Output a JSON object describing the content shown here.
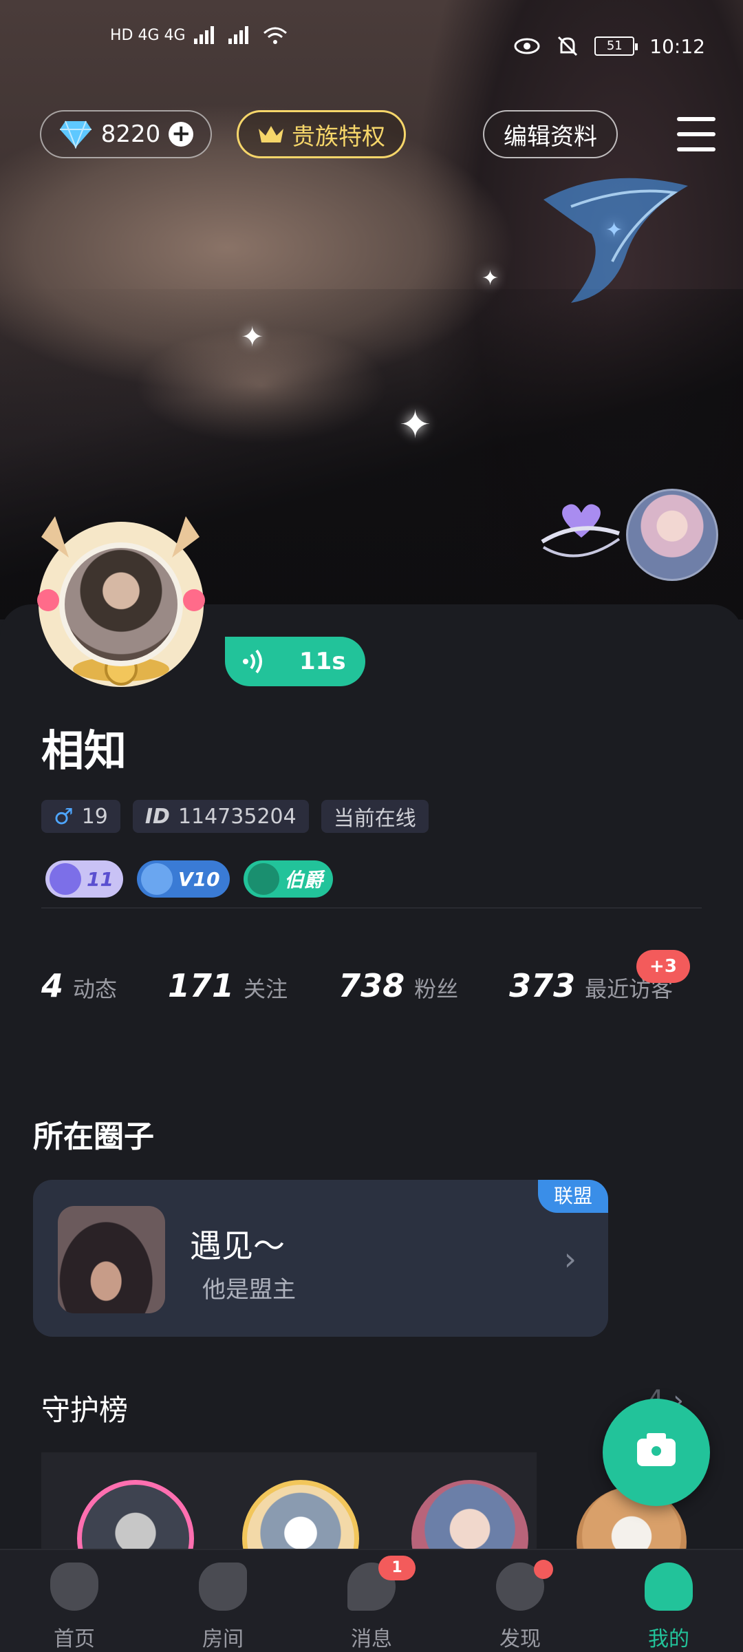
{
  "status_bar": {
    "left": "HD 4G 4G",
    "battery": "51",
    "time": "10:12"
  },
  "header": {
    "diamonds": "8220",
    "noble_label": "贵族特权",
    "edit_label": "编辑资料"
  },
  "profile": {
    "voice_duration": "11s",
    "name": "相知",
    "age": "19",
    "id_prefix": "ID",
    "id_value": "114735204",
    "online_status": "当前在线",
    "badges": [
      {
        "text": "11",
        "color": "#8e86e6"
      },
      {
        "text": "V10",
        "color": "#3a7bd5"
      },
      {
        "text": "伯爵",
        "color": "#22c39a"
      }
    ]
  },
  "stats": [
    {
      "value": "4",
      "label": "动态"
    },
    {
      "value": "171",
      "label": "关注"
    },
    {
      "value": "738",
      "label": "粉丝"
    },
    {
      "value": "373",
      "label": "最近访客"
    }
  ],
  "visitor_badge": "+3",
  "circle_section": {
    "title": "所在圈子",
    "name": "遇见～",
    "subtitle": "他是盟主",
    "tag": "联盟"
  },
  "guard_section": {
    "title": "守护榜",
    "count": "4"
  },
  "tabbar": [
    {
      "label": "首页",
      "icon": "mask-icon"
    },
    {
      "label": "房间",
      "icon": "room-icon"
    },
    {
      "label": "消息",
      "icon": "message-icon",
      "badge": "1"
    },
    {
      "label": "发现",
      "icon": "planet-icon"
    },
    {
      "label": "我的",
      "icon": "profile-icon"
    }
  ],
  "colors": {
    "accent": "#22c39a",
    "badge_red": "#f35b5b",
    "noble_gold": "#f6d66a"
  }
}
